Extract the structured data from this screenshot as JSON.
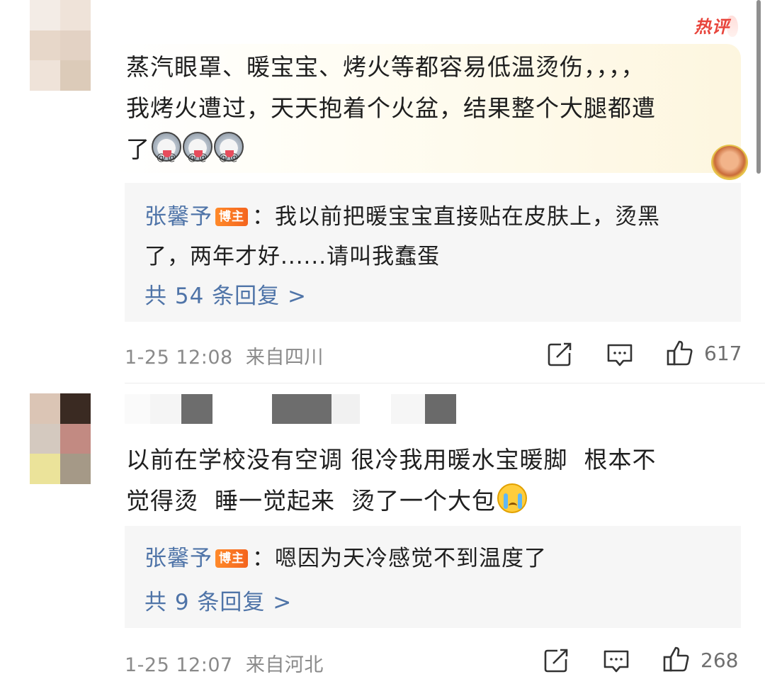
{
  "comments": [
    {
      "avatar_colors": [
        "#f3ece6",
        "#efe3d9",
        "#e7d7c9",
        "#e3d2c4",
        "#efe3d9",
        "#dccbb9"
      ],
      "hot_badge": "热评",
      "text_lines": [
        "蒸汽眼罩、暖宝宝、烤火等都容易低温烫伤，，，，",
        "我烤火遭过，天天抱着个火盆，结果整个大腿都遭",
        "了"
      ],
      "emoji_icons": [
        "dog-face",
        "dog-face",
        "dog-face"
      ],
      "reply": {
        "author": "张馨予",
        "badge": "博主",
        "line1": "：我以前把暖宝宝直接贴在皮肤上，烫黑",
        "line2": "了，两年才好......请叫我蠢蛋",
        "count": "共 54 条回复 >"
      },
      "timestamp": "1-25 12:08",
      "location": "来自四川",
      "likes": "617"
    },
    {
      "avatar_colors": [
        "#dbc5b5",
        "#3a2a22",
        "#d4c9bf",
        "#c28a82",
        "#ebe39a",
        "#a59987"
      ],
      "username_blocks": [
        "#fafafa",
        "#f5f5f5",
        "#6d6d6d",
        "#ffffff",
        "#f7f7f7",
        "#727272",
        "#f1f1f1",
        "#ffffff",
        "#f6f6f6",
        "#6a6a6a"
      ],
      "text_lines": [
        "以前在学校没有空调 很冷我用暖水宝暖脚  根本不",
        "觉得烫  睡一觉起来  烫了一个大包"
      ],
      "emoji_icons": [
        "crying-face"
      ],
      "reply": {
        "author": "张馨予",
        "badge": "博主",
        "line1": "：嗯因为天冷感觉不到温度了",
        "count": "共 9 条回复 >"
      },
      "timestamp": "1-25 12:07",
      "location": "来自河北",
      "likes": "268"
    }
  ],
  "colors": {
    "link": "#4f74a8",
    "badge": "#f4641e",
    "hot": "#e8453c",
    "reply_bg": "#f6f6f6",
    "meta": "#8a8a8a"
  }
}
